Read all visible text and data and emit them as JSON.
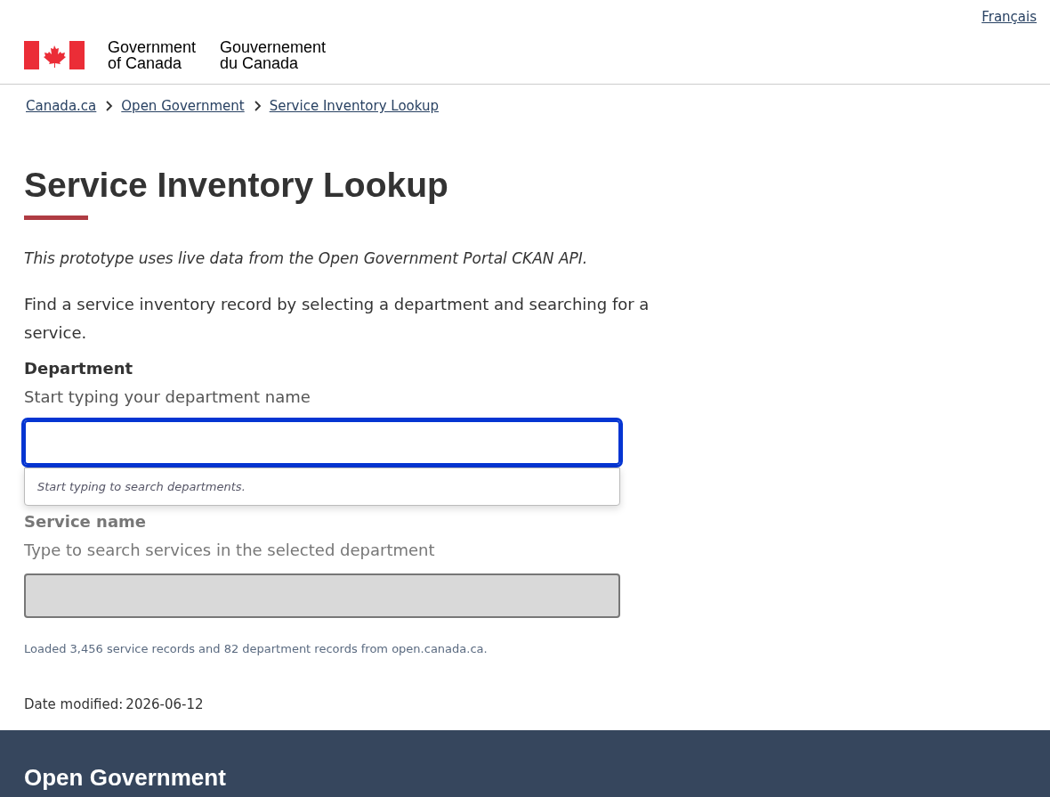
{
  "language_link": "Français",
  "signature": {
    "english": [
      "Government",
      "of Canada"
    ],
    "french": [
      "Gouvernement",
      "du Canada"
    ]
  },
  "breadcrumbs": [
    "Canada.ca",
    "Open Government",
    "Service Inventory Lookup"
  ],
  "title": "Service Inventory Lookup",
  "intro_note": "This prototype uses live data from the Open Government Portal CKAN API.",
  "intro": "Find a service inventory record by selecting a department and searching for a service.",
  "fields": [
    {
      "label": "Department",
      "hint": "Start typing your department name",
      "focused": true,
      "disabled": false,
      "dropdown_message": "Start typing to search departments."
    },
    {
      "label": "Service name",
      "hint": "Type to search services in the selected department",
      "focused": false,
      "disabled": true
    }
  ],
  "status": "Loaded 3,456 service records and 82 department records from open.canada.ca.",
  "date_modified": {
    "label": "Date modified:",
    "value": "2026-06-12"
  },
  "footer": {
    "title": "Open Government"
  }
}
